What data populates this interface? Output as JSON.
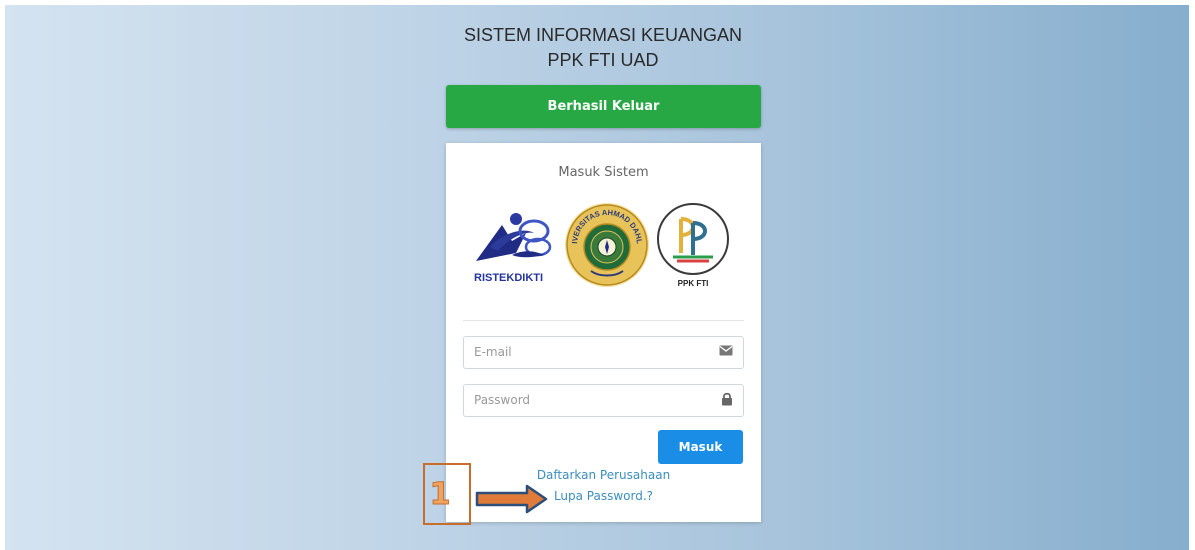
{
  "header": {
    "title_line1": "SISTEM INFORMASI KEUANGAN",
    "title_line2": "PPK FTI UAD"
  },
  "alert": {
    "message": "Berhasil Keluar",
    "color": "#28a745"
  },
  "login": {
    "heading": "Masuk Sistem",
    "logos": {
      "ristekdikti": "RISTEKDIKTI",
      "uad_seal": "UNIVERSITAS AHMAD DAHLAN",
      "ppk": "PPK FTI"
    },
    "email": {
      "placeholder": "E-mail",
      "icon": "envelope-icon"
    },
    "password": {
      "placeholder": "Password",
      "icon": "lock-icon"
    },
    "submit_label": "Masuk",
    "register_link": "Daftarkan Perusahaan",
    "forgot_link": "Lupa Password.?"
  },
  "annotation": {
    "number": "1",
    "color": "#e07b39"
  }
}
